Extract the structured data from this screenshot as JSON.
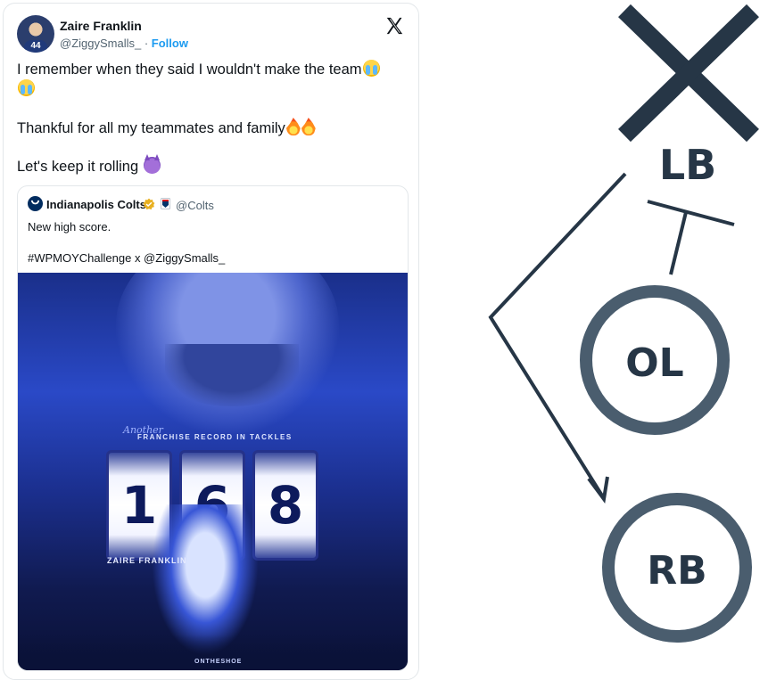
{
  "tweet": {
    "author_name": "Zaire Franklin",
    "author_handle": "@ZiggySmalls_",
    "separator": " · ",
    "follow_label": "Follow",
    "jersey_number": "44",
    "brand_icon": "x-logo-icon",
    "lines": [
      {
        "text": "I remember when they said I wouldn't make the team",
        "emojis": [
          "loudly-crying-face",
          "loudly-crying-face"
        ]
      },
      {
        "text": "Thankful for all my teammates and family",
        "emojis": [
          "fire",
          "fire"
        ]
      },
      {
        "text": "Let's keep it rolling ",
        "emojis": [
          "smiling-devil"
        ]
      }
    ],
    "line1": "I remember when they said I wouldn't make the team",
    "line2": "Thankful for all my teammates and family",
    "line3": "Let's keep it rolling "
  },
  "quote": {
    "author_name": "Indianapolis Colts",
    "author_handle": "@Colts",
    "icons": [
      "colts-horseshoe-icon",
      "verified-badge-icon",
      "nfl-affiliate-icon"
    ],
    "text_line1": "New high score.",
    "text_line2": "#WPMOYChallenge x @ZiggySmalls_",
    "media": {
      "script_text": "Another",
      "headline": "FRANCHISE RECORD IN TACKLES",
      "digits": [
        "1",
        "6",
        "8"
      ],
      "player_name": "ZAIRE FRANKLIN",
      "footer": "ONTHESHOE"
    }
  },
  "diagram": {
    "labels": {
      "lb": "LB",
      "ol": "OL",
      "rb": "RB"
    },
    "colors": {
      "stroke": "#263646",
      "ring": "#4a5d6e"
    }
  }
}
